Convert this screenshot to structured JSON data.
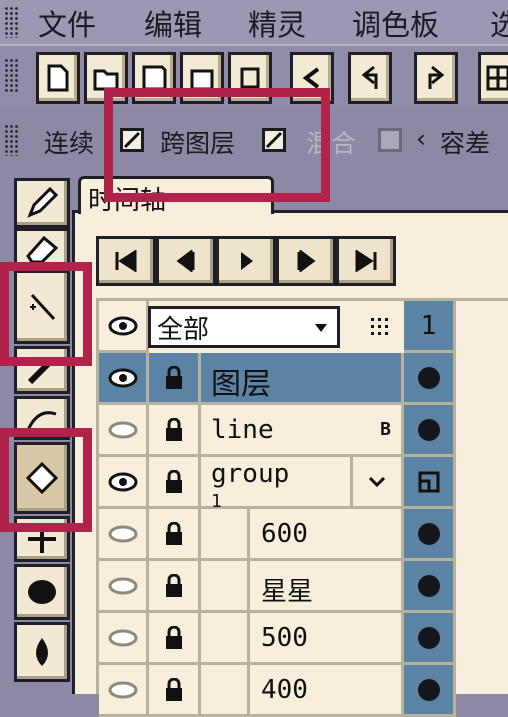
{
  "menu": {
    "items": [
      "文件",
      "编辑",
      "精灵",
      "调色板",
      "选"
    ]
  },
  "options": {
    "continuous_label": "连续",
    "cross_layer_label": "跨图层",
    "mix_label": "混合",
    "tolerance_label": "容差"
  },
  "timeline": {
    "tab_label": "时间轴",
    "filter_value": "全部",
    "frame_number": "1",
    "layers": [
      {
        "name": "图层",
        "visible": true,
        "selected": true
      },
      {
        "name": "line",
        "visible": false,
        "badge": "B"
      },
      {
        "name": "group",
        "visible": true,
        "subtext": "1",
        "group": true
      },
      {
        "name": "600",
        "visible": false
      },
      {
        "name": "星星",
        "visible": false
      },
      {
        "name": "500",
        "visible": false
      },
      {
        "name": "400",
        "visible": false
      }
    ]
  },
  "colors": {
    "highlight": "#b2234b",
    "selection": "#5b83a4",
    "panel": "#f7efdc"
  }
}
